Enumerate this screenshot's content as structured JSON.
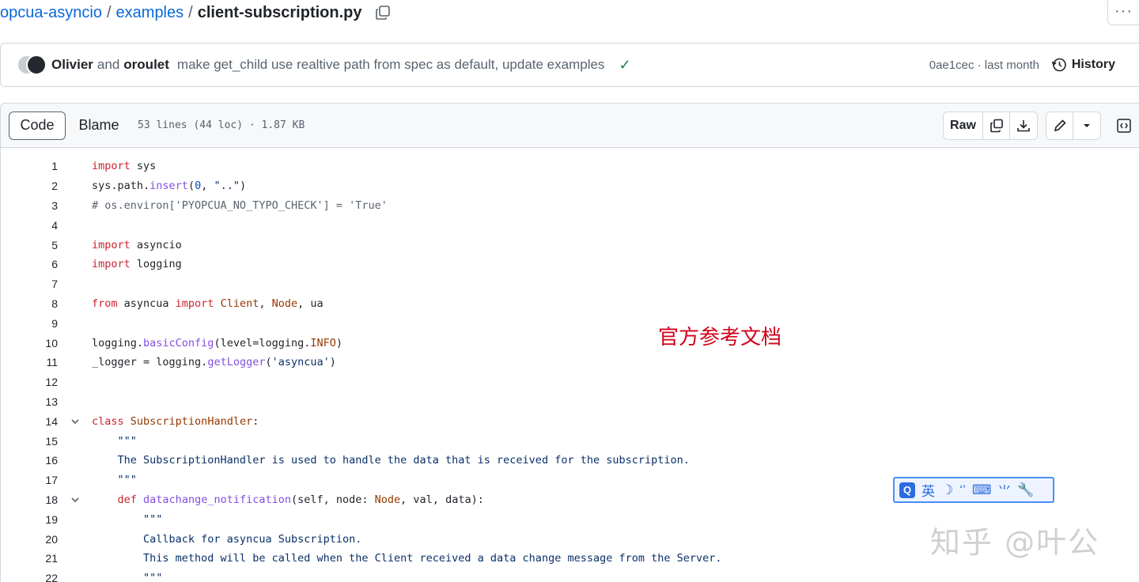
{
  "breadcrumb": {
    "repo": "opcua-asyncio",
    "separator": "/",
    "folder": "examples",
    "file": "client-subscription.py"
  },
  "header": {
    "more_label": "···"
  },
  "commit": {
    "author1": "Olivier",
    "and_text": "and",
    "author2": "oroulet",
    "message": "make get_child use realtive path from spec as default, update examples",
    "status": "✓",
    "sha_time": "0ae1cec · last month",
    "history_label": "History"
  },
  "file_header": {
    "tab_code": "Code",
    "tab_blame": "Blame",
    "info": "53 lines (44 loc) · 1.87 KB",
    "raw_label": "Raw"
  },
  "code_lines": [
    {
      "n": "1",
      "html": "<span class='k2'>import</span> sys"
    },
    {
      "n": "2",
      "html": "sys.path.<span class='f'>insert</span>(<span class='n'>0</span>, <span class='s'>\"..\"</span>)"
    },
    {
      "n": "3",
      "html": "<span class='c'># os.environ['PYOPCUA_NO_TYPO_CHECK'] = 'True'</span>"
    },
    {
      "n": "4",
      "html": ""
    },
    {
      "n": "5",
      "html": "<span class='k2'>import</span> asyncio"
    },
    {
      "n": "6",
      "html": "<span class='k2'>import</span> logging"
    },
    {
      "n": "7",
      "html": ""
    },
    {
      "n": "8",
      "html": "<span class='k2'>from</span> asyncua <span class='k2'>import</span> <span class='cls'>Client</span>, <span class='cls'>Node</span>, ua"
    },
    {
      "n": "9",
      "html": ""
    },
    {
      "n": "10",
      "html": "logging.<span class='f'>basicConfig</span>(level=logging.<span class='k'>INFO</span>)"
    },
    {
      "n": "11",
      "html": "_logger = logging.<span class='f'>getLogger</span>(<span class='s'>'asyncua'</span>)"
    },
    {
      "n": "12",
      "html": ""
    },
    {
      "n": "13",
      "html": ""
    },
    {
      "n": "14",
      "fold": true,
      "html": "<span class='k2'>class</span> <span class='cls'>SubscriptionHandler</span>:"
    },
    {
      "n": "15",
      "html": "    <span class='s'>\"\"\"</span>"
    },
    {
      "n": "16",
      "html": "<span class='s'>    The SubscriptionHandler is used to handle the data that is received for the subscription.</span>"
    },
    {
      "n": "17",
      "html": "<span class='s'>    \"\"\"</span>"
    },
    {
      "n": "18",
      "fold": true,
      "html": "    <span class='k2'>def</span> <span class='f'>datachange_notification</span>(self, node: <span class='cls'>Node</span>, val, data):"
    },
    {
      "n": "19",
      "html": "        <span class='s'>\"\"\"</span>"
    },
    {
      "n": "20",
      "html": "<span class='s'>        Callback for asyncua Subscription.</span>"
    },
    {
      "n": "21",
      "html": "<span class='s'>        This method will be called when the Client received a data change message from the Server.</span>"
    },
    {
      "n": "22",
      "html": "<span class='s'>        \"\"\"</span>"
    }
  ],
  "annotation": "官方参考文档",
  "ime_bar": {
    "logo": "Q",
    "lang": "英",
    "items": [
      "☽",
      "‘’",
      "⌨",
      "⺌",
      "🔧"
    ]
  },
  "watermark": "知乎 @叶公"
}
